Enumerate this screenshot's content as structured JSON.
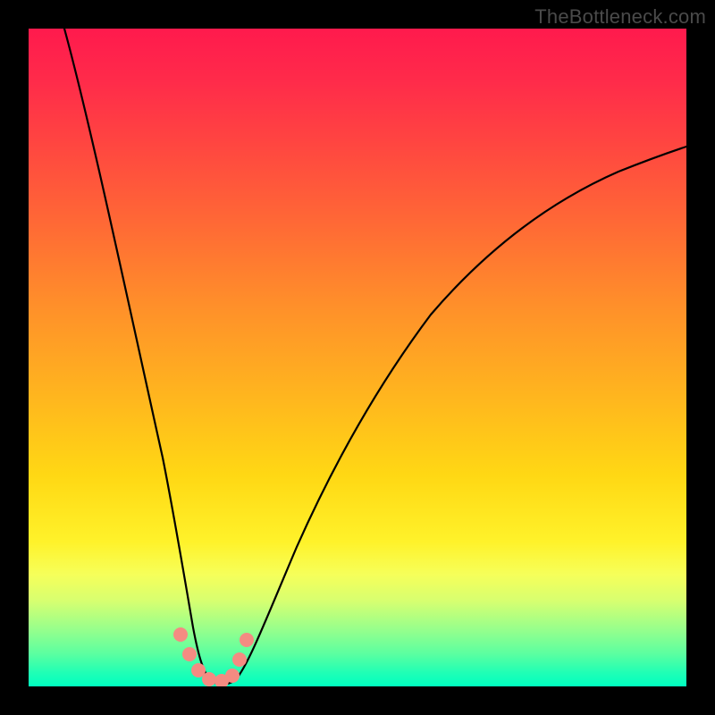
{
  "watermark": "TheBottleneck.com",
  "colors": {
    "frame": "#000000",
    "curve": "#000000",
    "markers": "#f48b82",
    "gradient_top": "#ff1a4d",
    "gradient_bottom": "#00ffc0"
  },
  "chart_data": {
    "type": "line",
    "title": "",
    "xlabel": "",
    "ylabel": "",
    "xlim": [
      0,
      100
    ],
    "ylim": [
      0,
      100
    ],
    "grid": false,
    "legend": false,
    "note": "Axes are unlabeled; values below are estimates read from pixel positions inside the 736×736 plot area, expressed as 0–100 coordinates (left→right, bottom→top). The curve is a V-shape: a steep descending left branch meeting a flat bottom, then a right branch that rises with decreasing slope.",
    "series": [
      {
        "name": "curve",
        "x": [
          5,
          10,
          15,
          18,
          20,
          22,
          24,
          25.5,
          27,
          28.5,
          30,
          32,
          35,
          40,
          45,
          50,
          55,
          60,
          70,
          80,
          90,
          100
        ],
        "y": [
          100,
          78,
          55,
          40,
          30,
          20,
          12,
          6,
          2,
          1,
          1,
          2,
          6,
          15,
          24,
          32,
          39,
          45,
          55,
          63,
          69,
          74
        ]
      }
    ],
    "markers": {
      "name": "highlight-dots",
      "note": "Salmon-colored dots clustered around the curve's minimum.",
      "x": [
        22.5,
        24,
        25.5,
        27,
        28.5,
        30,
        31.5,
        32.5
      ],
      "y": [
        8,
        4,
        2,
        1,
        1,
        2,
        5,
        8
      ]
    }
  }
}
